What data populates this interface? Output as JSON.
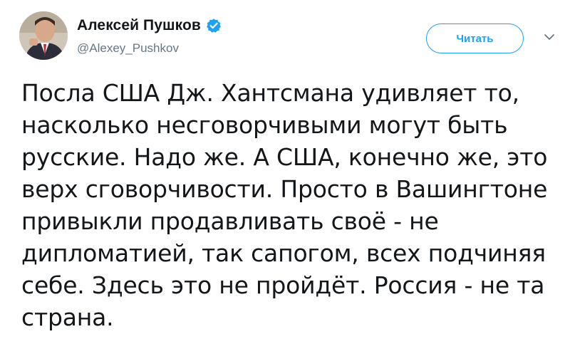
{
  "author": {
    "display_name": "Алексей Пушков",
    "handle": "@Alexey_Pushkov",
    "verified": true
  },
  "actions": {
    "follow_label": "Читать",
    "more_icon": "chevron-down-icon"
  },
  "tweet": {
    "lines": [
      "Посла США Дж. Хантсмана удивляет то,",
      "насколько несговорчивыми могут быть",
      "русские. Надо же. А США, конечно же, это",
      "верх сговорчивости. Просто в Вашингтоне",
      "привыкли продавливать своё - не",
      "дипломатией, так сапогом, всех подчиняя",
      "себе. Здесь это не пройдёт. Россия - не та",
      "страна."
    ]
  },
  "colors": {
    "accent": "#1da1f2",
    "text": "#14171a",
    "secondary": "#657786"
  }
}
